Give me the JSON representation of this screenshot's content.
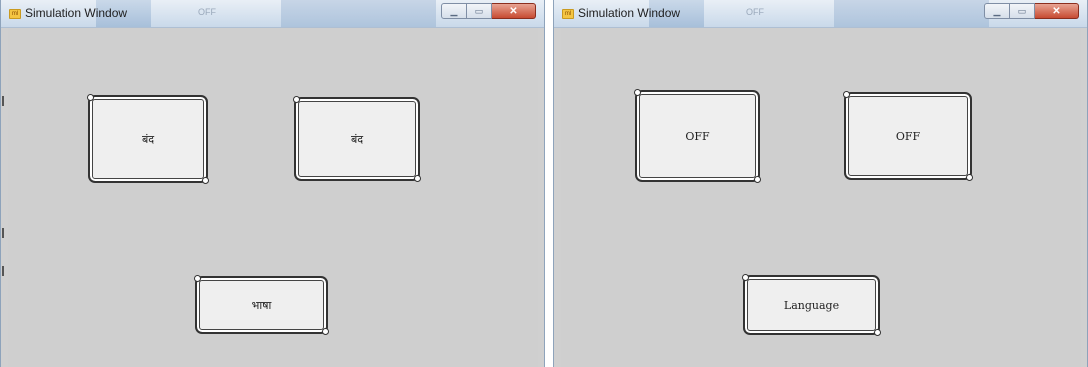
{
  "windows": [
    {
      "title": "Simulation Window",
      "ghost_title": "OFF",
      "buttons": {
        "left": "बंद",
        "right": "बंद",
        "language": "भाषा"
      }
    },
    {
      "title": "Simulation Window",
      "ghost_title": "OFF",
      "buttons": {
        "left": "OFF",
        "right": "OFF",
        "language": "Language"
      }
    }
  ],
  "colors": {
    "client_bg": "#cfcfcf",
    "button_bg": "#efefef",
    "close_red": "#c74b32"
  },
  "icons": {
    "app": "app-icon",
    "minimize": "minimize-icon",
    "maximize": "maximize-icon",
    "close": "close-icon"
  }
}
